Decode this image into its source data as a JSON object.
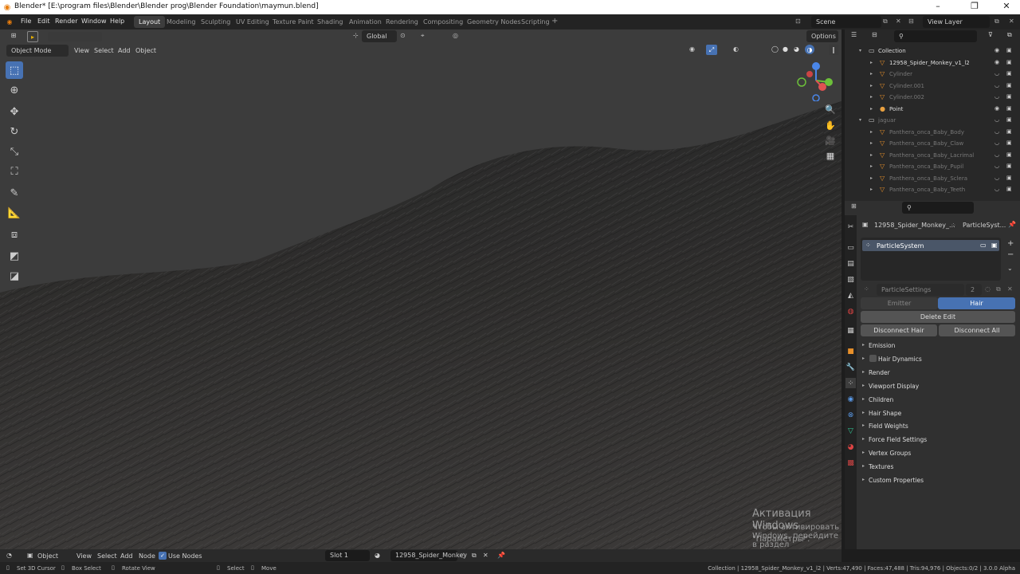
{
  "window": {
    "title": "Blender* [E:\\program files\\Blender\\Blender prog\\Blender Foundation\\maymun.blend]",
    "minimize": "–",
    "maximize": "❐",
    "close": "✕"
  },
  "menu": [
    "File",
    "Edit",
    "Render",
    "Window",
    "Help"
  ],
  "workspaces": [
    "Layout",
    "Modeling",
    "Sculpting",
    "UV Editing",
    "Texture Paint",
    "Shading",
    "Animation",
    "Rendering",
    "Compositing",
    "Geometry Nodes",
    "Scripting"
  ],
  "scene": {
    "label": "Scene",
    "view_layer": "View Layer"
  },
  "viewport_header": {
    "orientation": "Global",
    "options": "Options",
    "mode": "Object Mode",
    "menus": [
      "View",
      "Select",
      "Add",
      "Object"
    ]
  },
  "outliner": {
    "rows": [
      {
        "name": "Collection",
        "level": 0,
        "type": "collection"
      },
      {
        "name": "12958_Spider_Monkey_v1_l2",
        "level": 1,
        "type": "mesh"
      },
      {
        "name": "Cylinder",
        "level": 1,
        "type": "mesh",
        "dim": true
      },
      {
        "name": "Cylinder.001",
        "level": 1,
        "type": "mesh",
        "dim": true
      },
      {
        "name": "Cylinder.002",
        "level": 1,
        "type": "mesh",
        "dim": true
      },
      {
        "name": "Point",
        "level": 1,
        "type": "light"
      },
      {
        "name": "jaguar",
        "level": 0,
        "type": "collection",
        "dim": true
      },
      {
        "name": "Panthera_onca_Baby_Body",
        "level": 1,
        "type": "mesh",
        "dim": true
      },
      {
        "name": "Panthera_onca_Baby_Claw",
        "level": 1,
        "type": "mesh",
        "dim": true
      },
      {
        "name": "Panthera_onca_Baby_Lacrimal",
        "level": 1,
        "type": "mesh",
        "dim": true
      },
      {
        "name": "Panthera_onca_Baby_Pupil",
        "level": 1,
        "type": "mesh",
        "dim": true
      },
      {
        "name": "Panthera_onca_Baby_Sclera",
        "level": 1,
        "type": "mesh",
        "dim": true
      },
      {
        "name": "Panthera_onca_Baby_Teeth",
        "level": 1,
        "type": "mesh",
        "dim": true
      }
    ]
  },
  "properties": {
    "breadcrumb_object": "12958_Spider_Monkey_...",
    "breadcrumb_system": "ParticleSyst...",
    "particle_system": "ParticleSystem",
    "settings_name": "ParticleSettings",
    "settings_users": "2",
    "type_emitter": "Emitter",
    "type_hair": "Hair",
    "delete_edit": "Delete Edit",
    "disconnect_hair": "Disconnect Hair",
    "disconnect_all": "Disconnect All",
    "panels": [
      "Emission",
      "Hair Dynamics",
      "Render",
      "Viewport Display",
      "Children",
      "Hair Shape",
      "Field Weights",
      "Force Field Settings",
      "Vertex Groups",
      "Textures",
      "Custom Properties"
    ]
  },
  "timeline": {
    "mode": "Object",
    "menus": [
      "View",
      "Select",
      "Add",
      "Node"
    ],
    "use_nodes": "Use Nodes",
    "slot": "Slot 1",
    "material": "12958_Spider_Monkey"
  },
  "watermark": {
    "title": "Активация Windows",
    "line1": "Чтобы активировать Windows, перейдите в раздел",
    "line2": "\"Параметры\"."
  },
  "status": {
    "set_cursor": "Set 3D Cursor",
    "box_select": "Box Select",
    "rotate_view": "Rotate View",
    "select": "Select",
    "move": "Move",
    "stats": "Collection | 12958_Spider_Monkey_v1_l2 | Verts:47,490 | Faces:47,488 | Tris:94,976 | Objects:0/2 | 3.0.0 Alpha"
  },
  "colors": {
    "accent": "#4772b3",
    "fur": "#2b2b2b"
  }
}
